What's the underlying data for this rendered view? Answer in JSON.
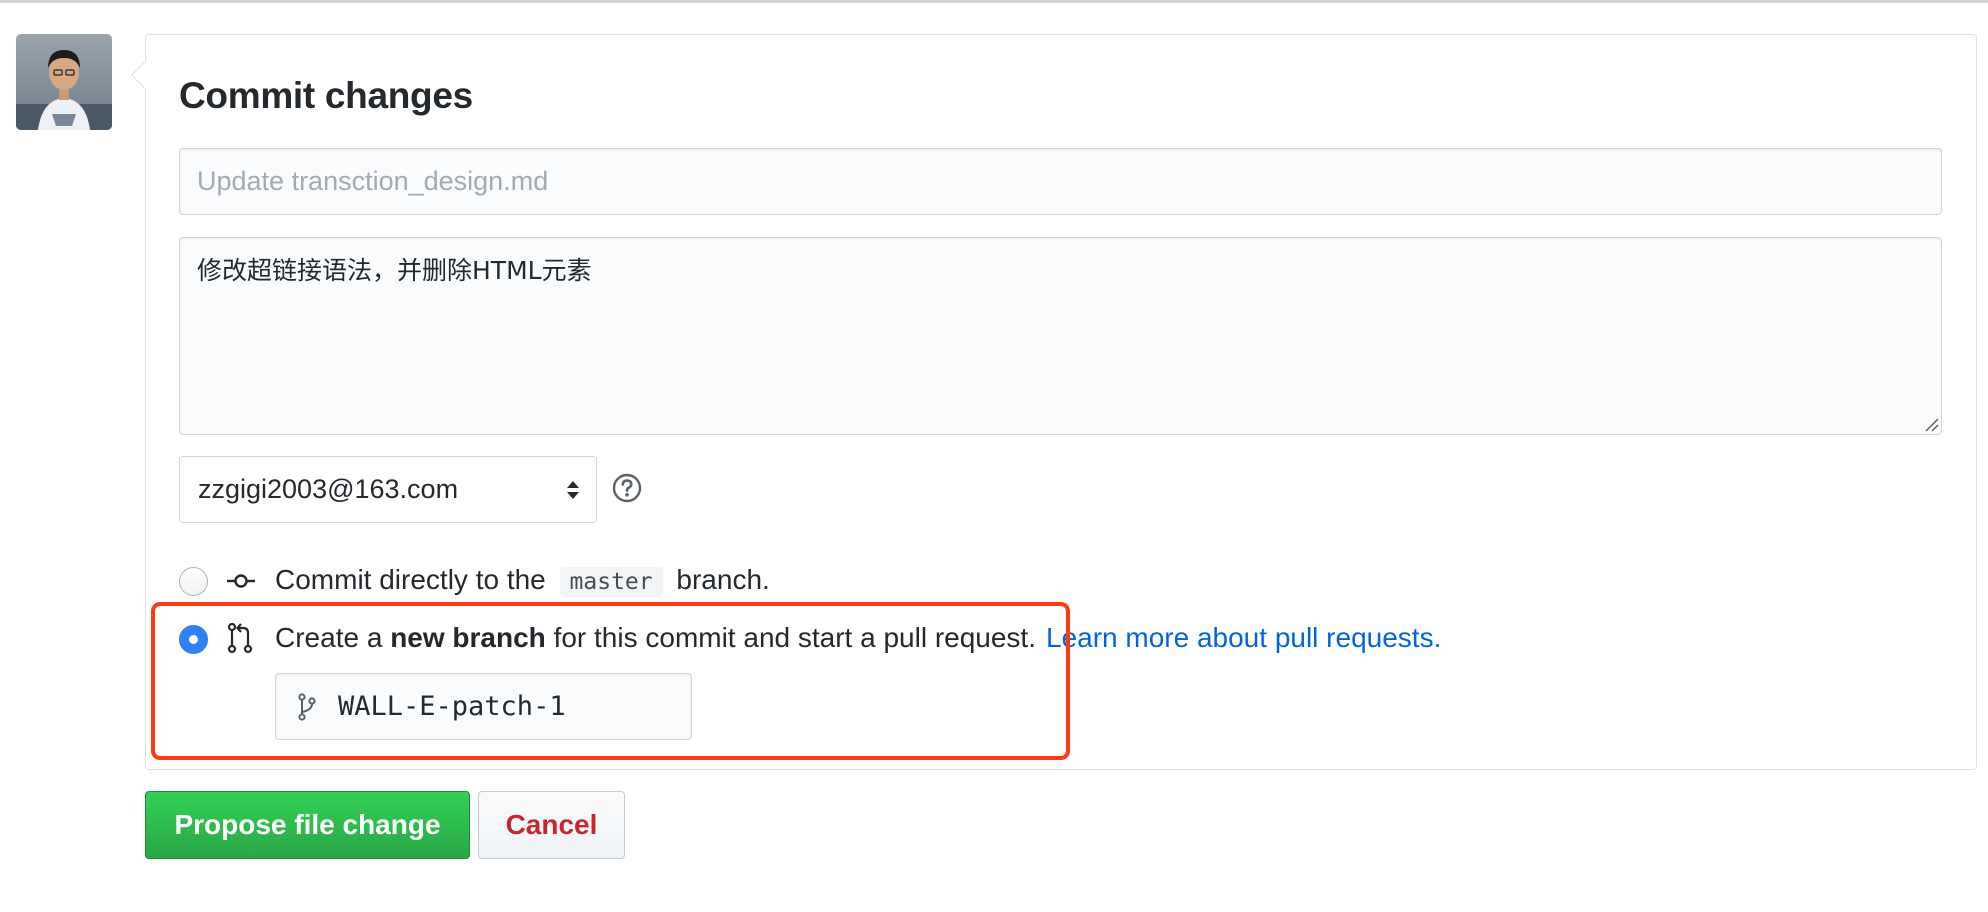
{
  "commit": {
    "title": "Commit changes",
    "summary_placeholder": "Update transction_design.md",
    "summary_value": "",
    "description": "修改超链接语法，并删除HTML元素",
    "author_email": "zzgigi2003@163.com",
    "options": {
      "direct": {
        "prefix": "Commit directly to the",
        "branch_name": "master",
        "suffix": "branch.",
        "checked": false,
        "icon": "git-commit-icon"
      },
      "new_branch": {
        "prefix": "Create a",
        "bold": "new branch",
        "suffix": "for this commit and start a pull request.",
        "link": "Learn more about pull requests.",
        "checked": true,
        "icon": "git-pull-request-icon"
      }
    },
    "new_branch_name": "WALL-E-patch-1",
    "propose_label": "Propose file change",
    "cancel_label": "Cancel"
  },
  "colors": {
    "primary_green": "#28a745",
    "cancel_red": "#cb2431",
    "link_blue": "#0366d6",
    "radio_blue": "#2f81f7",
    "highlight_orange": "#ff3a12"
  }
}
